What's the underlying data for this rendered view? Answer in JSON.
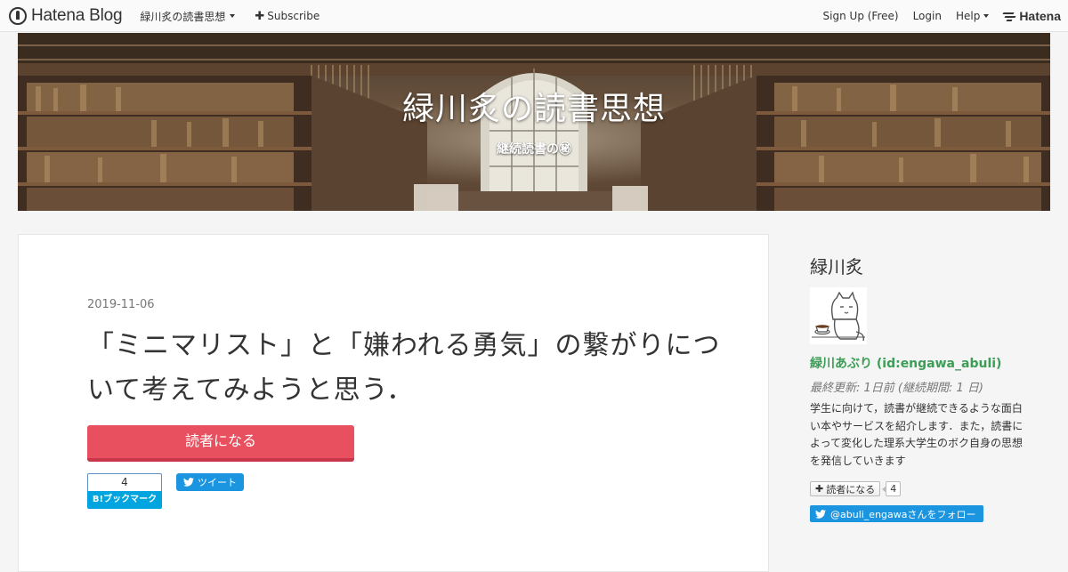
{
  "global_header": {
    "logo_text": "Hatena Blog",
    "blog_name": "緑川炙の読書思想",
    "subscribe_label": "Subscribe",
    "signup_label": "Sign Up (Free)",
    "login_label": "Login",
    "help_label": "Help",
    "hatena_label": "Hatena"
  },
  "hero": {
    "title": "緑川炙の読書思想",
    "subtitle": "継続読書の㊙"
  },
  "entry": {
    "date": "2019-11-06",
    "title": "「ミニマリスト」と「嫌われる勇気」の繋がりについて考えてみようと思う．",
    "subscribe_button": "読者になる",
    "bookmark_count": "4",
    "bookmark_label": "B!ブックマーク",
    "tweet_label": "ツイート"
  },
  "sidebar": {
    "name": "緑川炙",
    "user_id": "緑川あぶり (id:engawa_abuli)",
    "last_updated": "最終更新: 1日前 (継続期間: 1 日)",
    "description": "学生に向けて，読書が継続できるような面白い本やサービスを紹介します．また，読書によって変化した理系大学生のボク自身の思想を発信していきます",
    "reader_button": "読者になる",
    "reader_count": "4",
    "twitter_follow": "@abuli_engawaさんをフォロー"
  },
  "colors": {
    "subscribe_red": "#e9505f",
    "user_id_green": "#3c9d56",
    "twitter_blue": "#1b95e0",
    "hatena_bookmark_blue": "#00a4de"
  }
}
